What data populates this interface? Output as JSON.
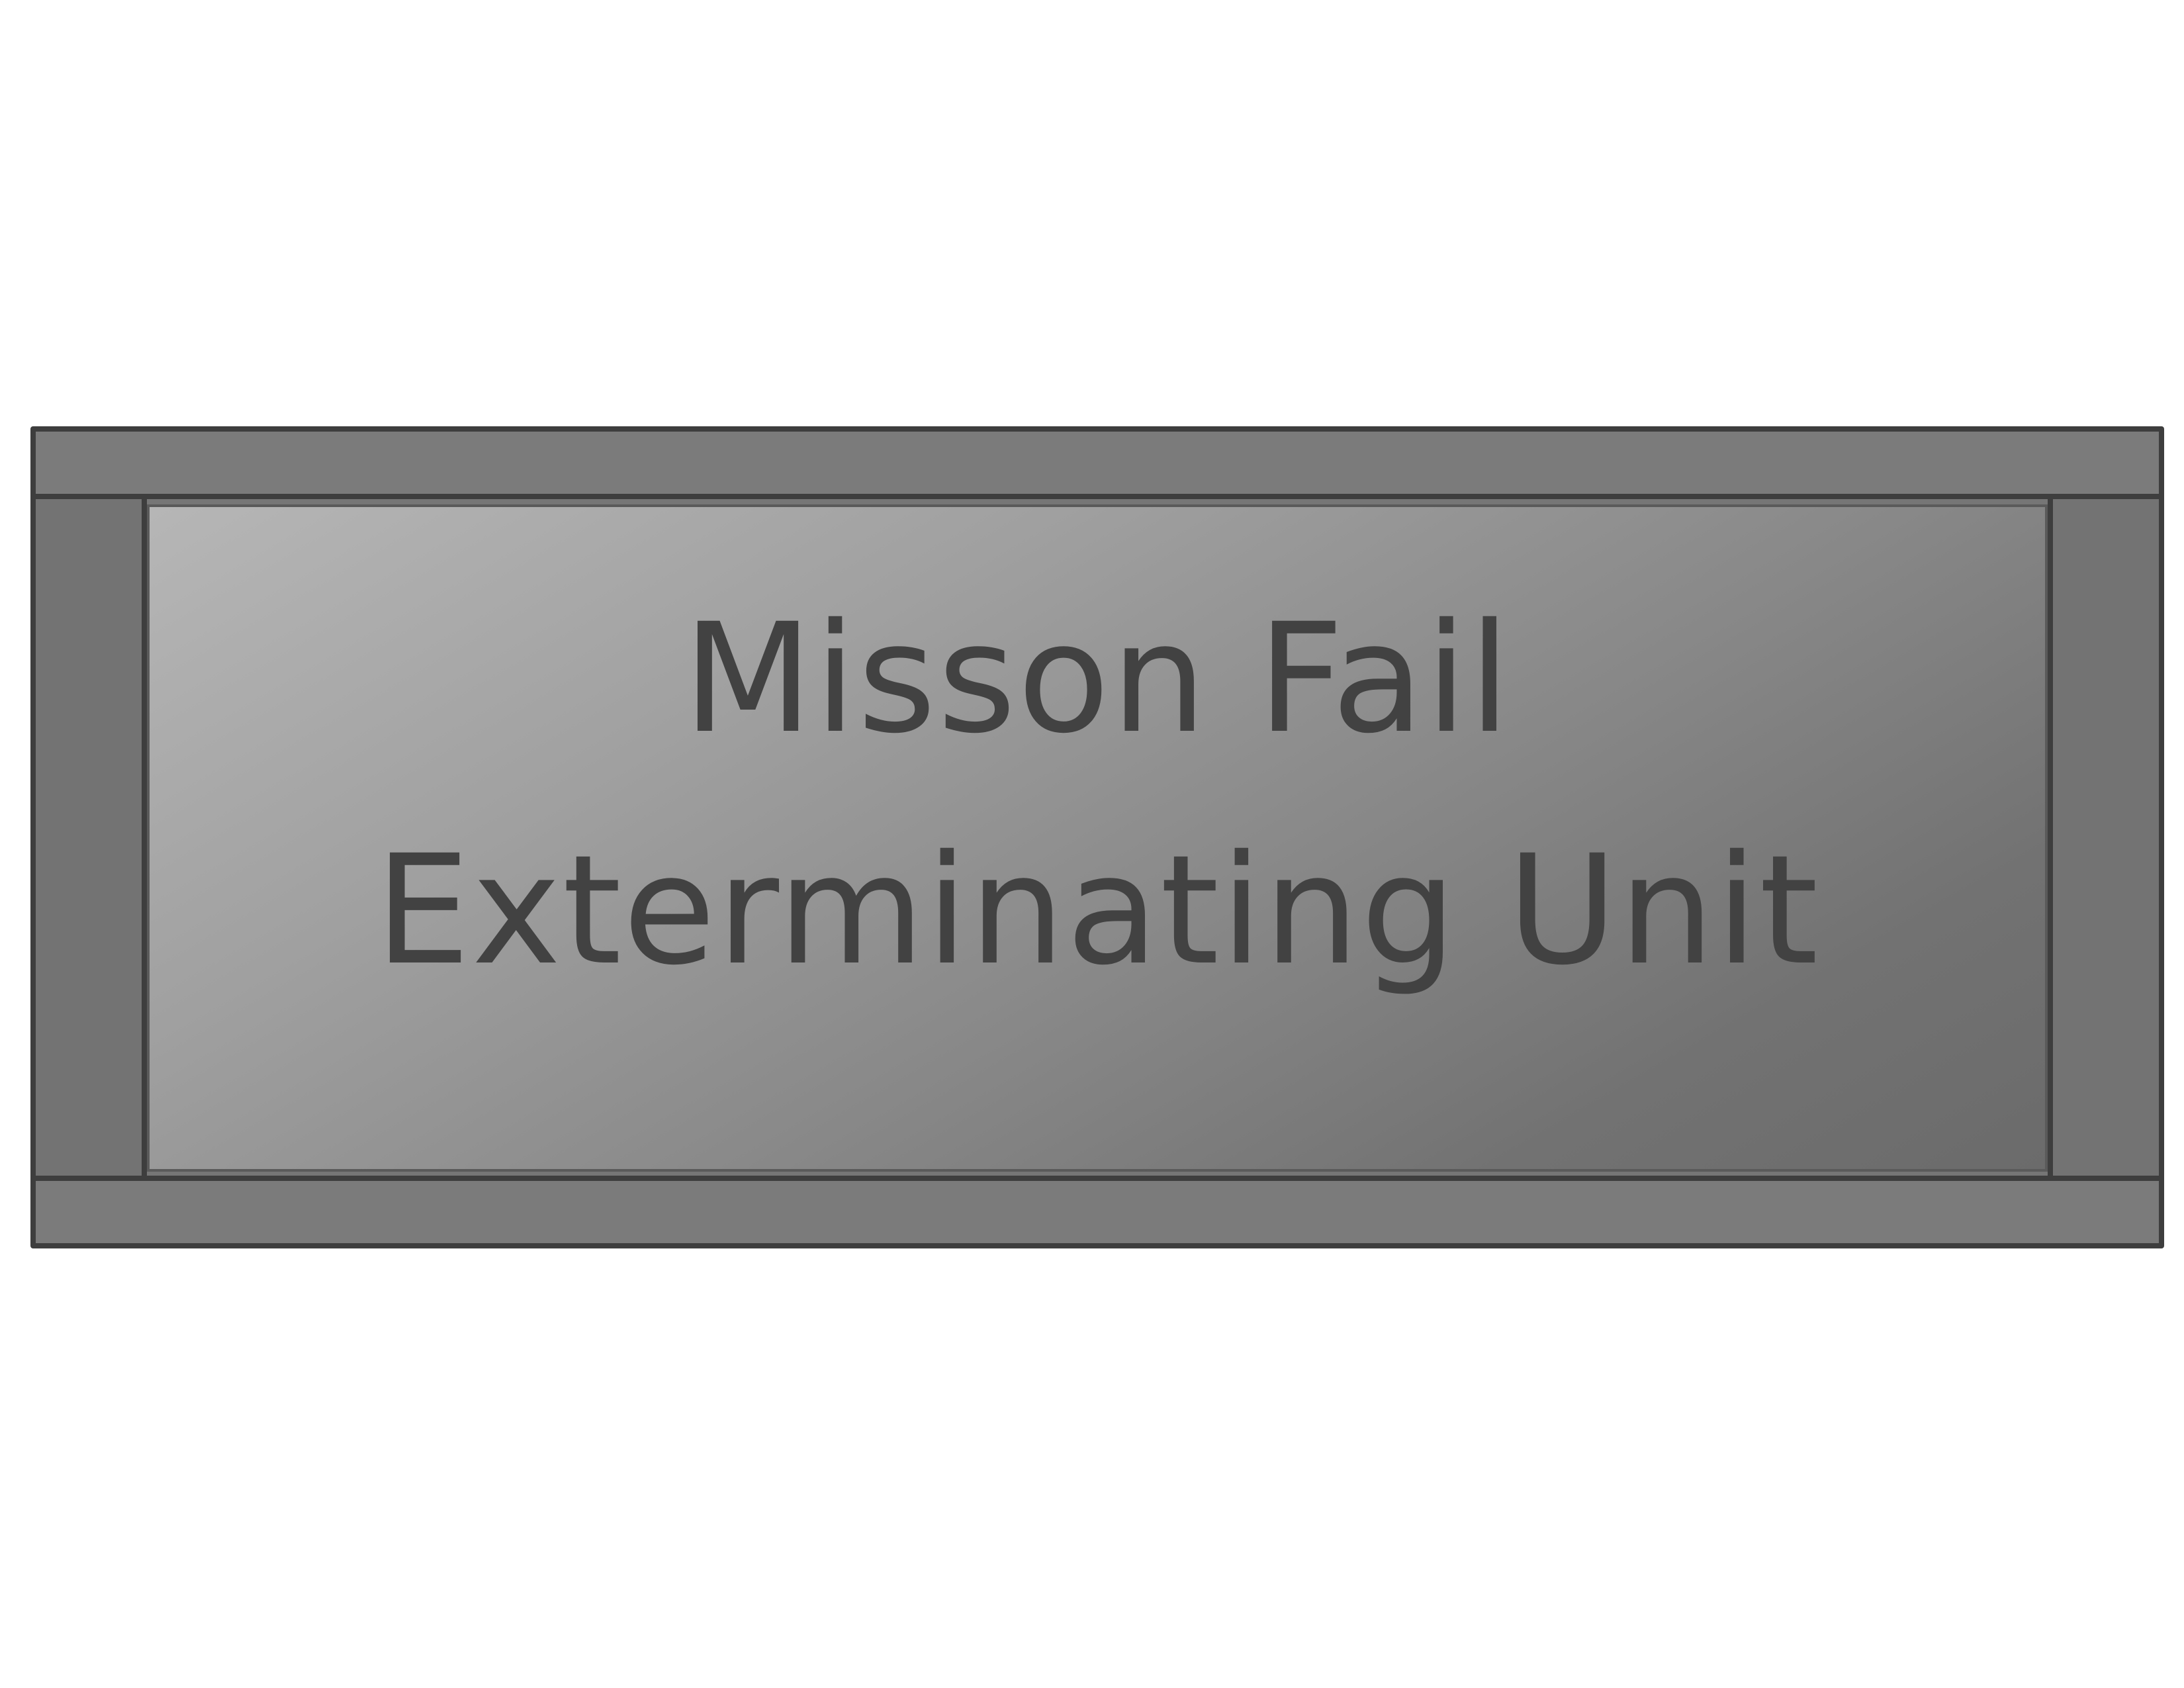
{
  "sign": {
    "line1": "Misson Fail",
    "line2": "Exterminating Unit"
  },
  "colors": {
    "frame": "#7b7b7b",
    "border": "#3e3e3e",
    "panel_light": "#b6b6b6",
    "panel_dark": "#6b6b6b",
    "text": "#424242"
  }
}
